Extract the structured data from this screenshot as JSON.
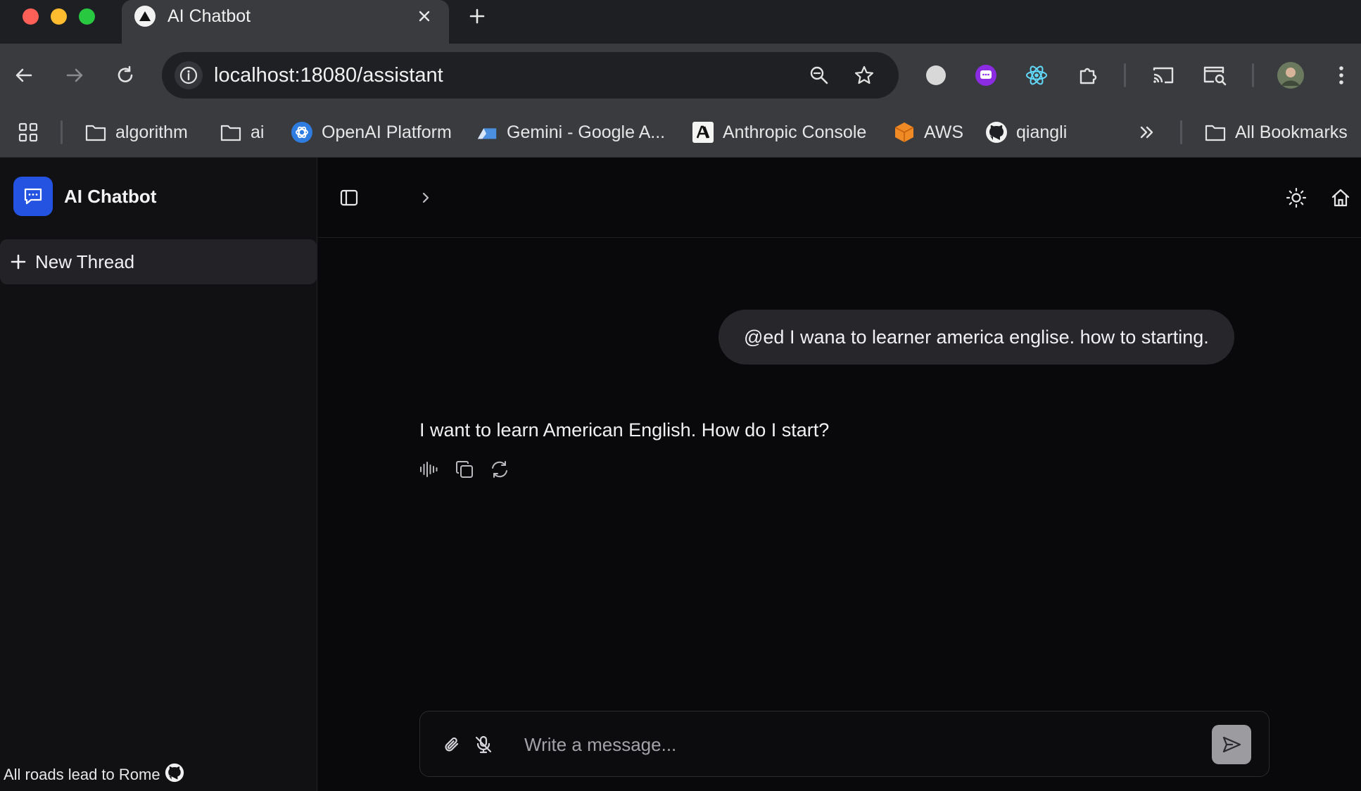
{
  "browser": {
    "tab": {
      "title": "AI Chatbot"
    },
    "address_bar": {
      "url": "localhost:18080/assistant"
    },
    "bookmarks": [
      {
        "label": "algorithm",
        "icon": "folder-icon"
      },
      {
        "label": "ai",
        "icon": "folder-icon"
      },
      {
        "label": "OpenAI Platform",
        "icon": "openai-icon"
      },
      {
        "label": "Gemini - Google A...",
        "icon": "gemini-icon"
      },
      {
        "label": "Anthropic Console",
        "icon": "anthropic-icon"
      },
      {
        "label": "AWS",
        "icon": "aws-icon"
      },
      {
        "label": "qiangli",
        "icon": "github-icon"
      }
    ],
    "all_bookmarks_label": "All Bookmarks"
  },
  "sidebar": {
    "brand": "AI Chatbot",
    "new_thread_label": "New Thread",
    "footer_text": "All roads lead to Rome"
  },
  "conversation": {
    "user_message": "@ed I wana to learner america englise. how to starting.",
    "assistant_message": "I want to learn American English. How do I start?"
  },
  "composer": {
    "placeholder": "Write a message..."
  },
  "colors": {
    "brand_accent": "#2353e0",
    "background": "#09090b",
    "sidebar": "#111114",
    "user_bubble": "#27272b"
  }
}
